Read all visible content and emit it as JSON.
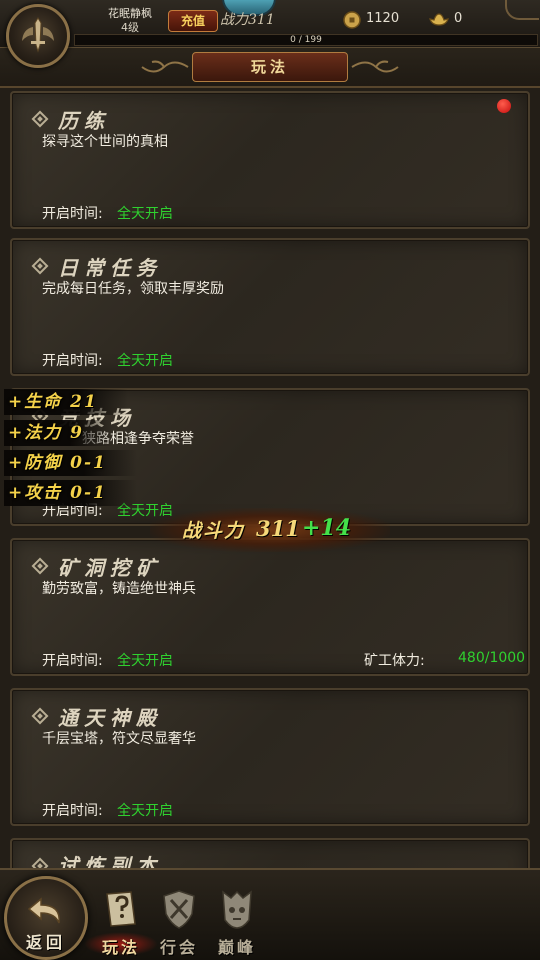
{
  "header": {
    "player_name": "花眠静枫",
    "player_level": "4级",
    "recharge_label": "充值",
    "power_small": "战力311",
    "gold": "1120",
    "ingot": "0",
    "exp_text": "0 / 199",
    "exp_progress": 0
  },
  "page_title": "玩法",
  "cards": [
    {
      "title": "历练",
      "desc": "探寻这个世间的真相",
      "time_label": "开启时间:",
      "time_value": "全天开启",
      "has_notice": true
    },
    {
      "title": "日常任务",
      "desc": "完成每日任务，领取丰厚奖励",
      "time_label": "开启时间:",
      "time_value": "全天开启"
    },
    {
      "title": "竞技场",
      "desc": "狭路相逢争夺荣誉",
      "time_label": "开启时间:",
      "time_value": "全天开启"
    },
    {
      "title": "矿洞挖矿",
      "desc": "勤劳致富，铸造绝世神兵",
      "time_label": "开启时间:",
      "time_value": "全天开启",
      "stamina_label": "矿工体力:",
      "stamina_value": "480/1000"
    },
    {
      "title": "通天神殿",
      "desc": "千层宝塔，符文尽显奢华",
      "time_label": "开启时间:",
      "time_value": "全天开启"
    },
    {
      "title": "试炼副本"
    }
  ],
  "stat_popups": [
    "+生命 21",
    "+法力 9",
    "+防御 0-1",
    "+攻击 0-1"
  ],
  "power_popup": {
    "label": "战斗力",
    "value": "311",
    "delta": "+14"
  },
  "bottom_nav": {
    "back_label": "返回",
    "items": [
      {
        "label": "玩法",
        "icon": "scroll-quest-icon",
        "active": true
      },
      {
        "label": "行会",
        "icon": "guild-shield-icon",
        "active": false
      },
      {
        "label": "巅峰",
        "icon": "peak-skull-icon",
        "active": false
      }
    ]
  },
  "colors": {
    "accent_green": "#2fd12f",
    "popup_gold": "#f4d24a",
    "notice_red": "#e01c1c"
  }
}
